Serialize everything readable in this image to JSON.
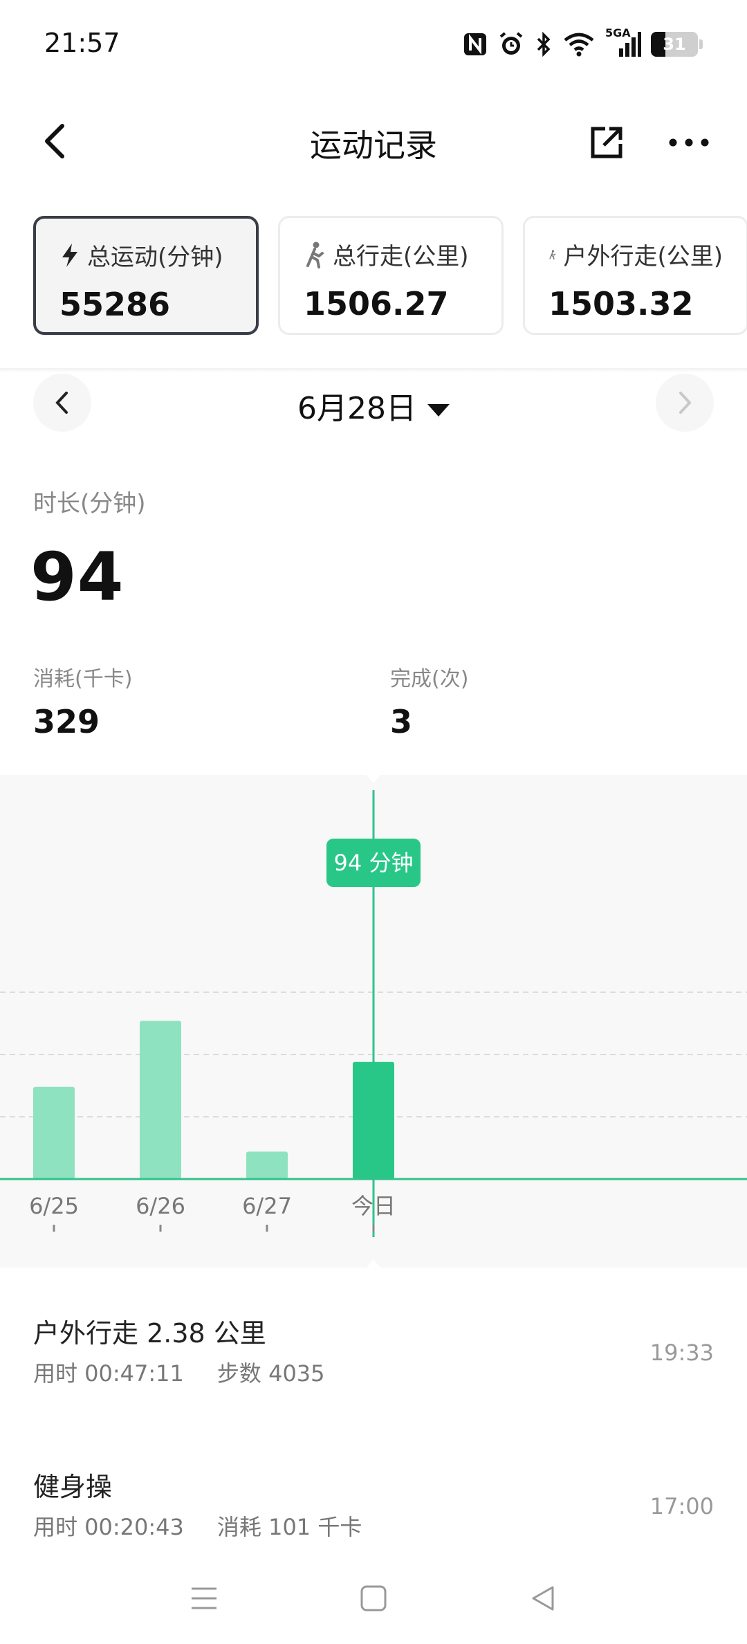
{
  "status_bar": {
    "time": "21:57",
    "network": "5GA",
    "battery": "31",
    "battery_level": 0.31,
    "icons": [
      "nfc-icon",
      "alarm-icon",
      "bluetooth-icon",
      "wifi-icon",
      "cellular-signal-icon",
      "battery-icon"
    ]
  },
  "header": {
    "title": "运动记录",
    "back_icon": "chevron-left-icon",
    "share_icon": "share-external-icon",
    "more_icon": "more-dots-icon"
  },
  "metric_cards": [
    {
      "label": "总运动(分钟)",
      "value": "55286",
      "icon": "lightning-icon",
      "active": true
    },
    {
      "label": "总行走(公里)",
      "value": "1506.27",
      "icon": "walking-icon",
      "active": false
    },
    {
      "label": "户外行走(公里)",
      "value": "1503.32",
      "icon": "walking-icon",
      "active": false
    }
  ],
  "date_nav": {
    "date": "6月28日"
  },
  "summary": {
    "duration_label": "时长(分钟)",
    "duration_value": "94",
    "calories_label": "消耗(千卡)",
    "calories_value": "329",
    "completed_label": "完成(次)",
    "completed_value": "3"
  },
  "chart_data": {
    "type": "bar",
    "categories": [
      "6/25",
      "6/26",
      "6/27",
      "今日"
    ],
    "values": [
      74,
      127,
      22,
      94
    ],
    "selected_index": 3,
    "tooltip": "94 分钟",
    "gridlines": [
      50,
      100,
      150
    ],
    "ylim": [
      0,
      200
    ],
    "colors": {
      "bar": "#8fe2bf",
      "selected_bar": "#28c788",
      "axis": "#32c28a",
      "grid": "#dcdcdc"
    }
  },
  "activities": [
    {
      "title": "户外行走 2.38 公里",
      "detail1": "用时 00:47:11",
      "detail2": "步数 4035",
      "time": "19:33"
    },
    {
      "title": "健身操",
      "detail1": "用时 00:20:43",
      "detail2": "消耗 101 千卡",
      "time": "17:00"
    }
  ],
  "nav_bar": {
    "icons": [
      "menu-icon",
      "home-icon",
      "back-triangle-icon"
    ]
  }
}
